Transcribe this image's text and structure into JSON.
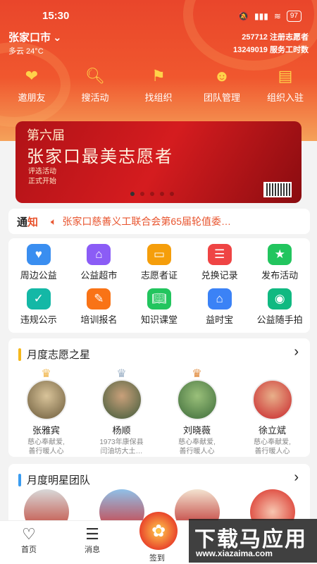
{
  "status": {
    "time": "15:30",
    "battery": "97"
  },
  "header": {
    "city": "张家口市",
    "weather": "多云 24°C",
    "stat1_num": "257712",
    "stat1_label": "注册志愿者",
    "stat2_num": "13249019",
    "stat2_label": "服务工时数"
  },
  "quick": [
    {
      "label": "邀朋友",
      "icon": "handshake-icon"
    },
    {
      "label": "搜活动",
      "icon": "search-icon"
    },
    {
      "label": "找组织",
      "icon": "flag-icon"
    },
    {
      "label": "团队管理",
      "icon": "team-icon"
    },
    {
      "label": "组织入驻",
      "icon": "clipboard-icon"
    }
  ],
  "banner": {
    "line1": "第六届",
    "line2": "张家口最美志愿者",
    "line3": "评选活动",
    "line4": "正式开始"
  },
  "notice": {
    "label_a": "通",
    "label_b": "知",
    "text": "张家口慈善义工联合会第65届轮值委…"
  },
  "grid": [
    {
      "label": "周边公益",
      "color": "#3a8ef0"
    },
    {
      "label": "公益超市",
      "color": "#8b5cf6"
    },
    {
      "label": "志愿者证",
      "color": "#f59e0b"
    },
    {
      "label": "兑换记录",
      "color": "#ef4444"
    },
    {
      "label": "发布活动",
      "color": "#22c55e"
    },
    {
      "label": "违规公示",
      "color": "#14b8a6"
    },
    {
      "label": "培训报名",
      "color": "#f97316"
    },
    {
      "label": "知识课堂",
      "color": "#22c55e"
    },
    {
      "label": "益时宝",
      "color": "#3b82f6"
    },
    {
      "label": "公益随手拍",
      "color": "#10b981"
    }
  ],
  "stars_section": {
    "title": "月度志愿之星"
  },
  "stars": [
    {
      "name": "张雅宾",
      "desc1": "慈心奉献爱,",
      "desc2": "善行暖人心"
    },
    {
      "name": "杨顺",
      "desc1": "1973年康保县",
      "desc2": "闫油坊大土…"
    },
    {
      "name": "刘晓薇",
      "desc1": "慈心奉献爱,",
      "desc2": "善行暖人心"
    },
    {
      "name": "徐立斌",
      "desc1": "慈心奉献爱,",
      "desc2": "善行暖人心"
    }
  ],
  "teams_section": {
    "title": "月度明星团队"
  },
  "nav": {
    "home": "首页",
    "msg": "消息",
    "sign": "签到"
  },
  "watermark": {
    "big": "下载马应用",
    "small": "www.xiazaima.com"
  }
}
